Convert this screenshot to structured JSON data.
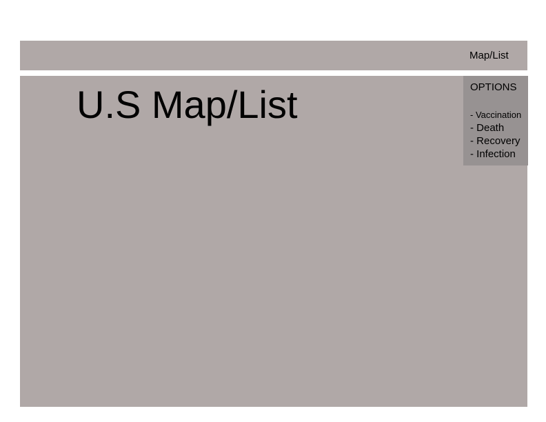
{
  "header": {
    "nav_link": "Map/List"
  },
  "main": {
    "title": "U.S Map/List"
  },
  "options": {
    "heading": "OPTIONS",
    "items": [
      {
        "label": "- Vaccination"
      },
      {
        "label": "- Death"
      },
      {
        "label": "- Recovery"
      },
      {
        "label": "- Infection"
      }
    ]
  },
  "colors": {
    "panel_background": "#b0a8a7",
    "options_background": "#979292",
    "page_background": "#ffffff",
    "text": "#000000"
  }
}
